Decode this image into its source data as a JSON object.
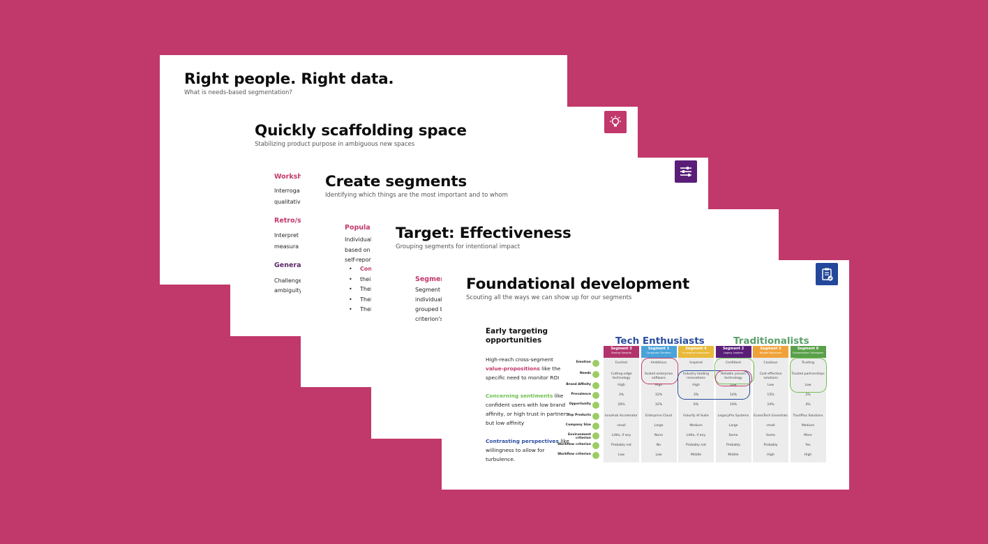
{
  "slides": [
    {
      "title": "Right people. Right data.",
      "subtitle": "What is needs-based segmentation?"
    },
    {
      "title": "Quickly scaffolding space",
      "subtitle": "Stabilizing product purpose in ambiguous new spaces",
      "icon": "lightbulb-gear-icon",
      "icon_color": "#c1386b",
      "sections": [
        {
          "heading": "Worksh",
          "color": "#c1386b",
          "lines": [
            "Interroga",
            "qualitativ"
          ]
        },
        {
          "heading": "Retro/s",
          "color": "#c1386b",
          "lines": [
            "Interpret",
            "measura"
          ]
        },
        {
          "heading": "Genera",
          "color": "#5d2b6b",
          "lines": [
            "Challenge",
            "ambiguity"
          ]
        }
      ]
    },
    {
      "title": "Create segments",
      "subtitle": "Identifying which things are the most important and to whom",
      "icon": "sliders-icon",
      "icon_color": "#5a1e79",
      "section": {
        "heading": "Popula",
        "color": "#c1386b",
        "lines": [
          "Individual",
          "based on",
          "self-repor"
        ]
      },
      "bullets": [
        {
          "text": "Con",
          "highlight": true
        },
        {
          "text": "their",
          "highlight": false,
          "continuation": true
        },
        {
          "text": "Thei",
          "highlight": false
        },
        {
          "text": "Thei",
          "highlight": false
        },
        {
          "text": "Thei",
          "highlight": false
        }
      ]
    },
    {
      "title": "Target: Effectiveness",
      "subtitle": "Grouping segments for intentional impact",
      "section": {
        "heading": "Segmen",
        "color": "#c1386b",
        "lines": [
          "Segment",
          "individual",
          "grouped b",
          "criterion's"
        ]
      }
    },
    {
      "title": "Foundational development",
      "subtitle": "Scouting all the ways we can show up for our segments",
      "icon": "clipboard-check-icon",
      "icon_color": "#23479a",
      "left_title": "Early targeting opportunities",
      "paragraphs": [
        {
          "pre": "High-reach cross-segment ",
          "emph": "value-propositions",
          "emph_color": "#c1386b",
          "post": " like  the specific need to monitor ROI"
        },
        {
          "pre": "",
          "emph": "Concerning sentiments",
          "emph_color": "#6fbf4e",
          "post": " like confident users with low brand affinity, or high trust in partners but low affinity"
        },
        {
          "pre": "",
          "emph": "Contrasting perspectives",
          "emph_color": "#2a4da0",
          "post": " like willingness to allow for turbulence."
        }
      ],
      "groups": [
        {
          "label": "Tech Enthusiasts",
          "color": "#2a4da0"
        },
        {
          "label": "Traditionalists",
          "color": "#5aa06a"
        }
      ],
      "row_labels": [
        "Emotion",
        "Needs",
        "Brand Affinity",
        "Prevalence",
        "Opportunity",
        "Top Products",
        "Company Size",
        "Environment criterion",
        "Workflow criterion",
        "Workflow criterion"
      ],
      "segments": [
        {
          "name": "Segment 3",
          "sub": "Startup Savants",
          "color": "#b2336b",
          "values": [
            "Excited",
            "Cutting-edge technology",
            "High",
            "3%",
            "26%",
            "InnoHub Accelerator",
            "small",
            "Little, if any",
            "Probably not",
            "Low"
          ]
        },
        {
          "name": "Segment 1",
          "sub": "Corporate Climbers",
          "color": "#4aa3d9",
          "values": [
            "Ambitious",
            "Scaled enterprise software",
            "High",
            "32%",
            "32%",
            "Enterprise Cloud",
            "Large",
            "None",
            "No",
            "Low"
          ]
        },
        {
          "name": "Segment 4",
          "sub": "Innovation Advocates",
          "color": "#e8b93a",
          "values": [
            "Inspired",
            "Industry leading innovations",
            "High",
            "3%",
            "6%",
            "Futurify AI Suite",
            "Medium",
            "Little, if any",
            "Probably not",
            "Middle"
          ]
        },
        {
          "name": "Segment 2",
          "sub": "Legacy Leaders",
          "color": "#5a1e79",
          "values": [
            "Confident",
            "Reliable proven technology",
            "Low",
            "14%",
            "19%",
            "LegacyPro Systems",
            "Large",
            "Some",
            "Probably",
            "Middle"
          ]
        },
        {
          "name": "Segment 5",
          "sub": "Budget Balancers",
          "color": "#f0a23a",
          "values": [
            "Cautious",
            "Cost-effective solutions",
            "Low",
            "15%",
            "24%",
            "EconoTech Essentials",
            "small",
            "Some",
            "Probably",
            "High"
          ]
        },
        {
          "name": "Segment 6",
          "sub": "Conservative Colleagues",
          "color": "#5aa04a",
          "values": [
            "Trusting",
            "Trusted partnerships",
            "Low",
            "2%",
            "4%",
            "TrustPlus Solutions",
            "Medium",
            "More",
            "Yes",
            "High"
          ]
        }
      ]
    }
  ]
}
